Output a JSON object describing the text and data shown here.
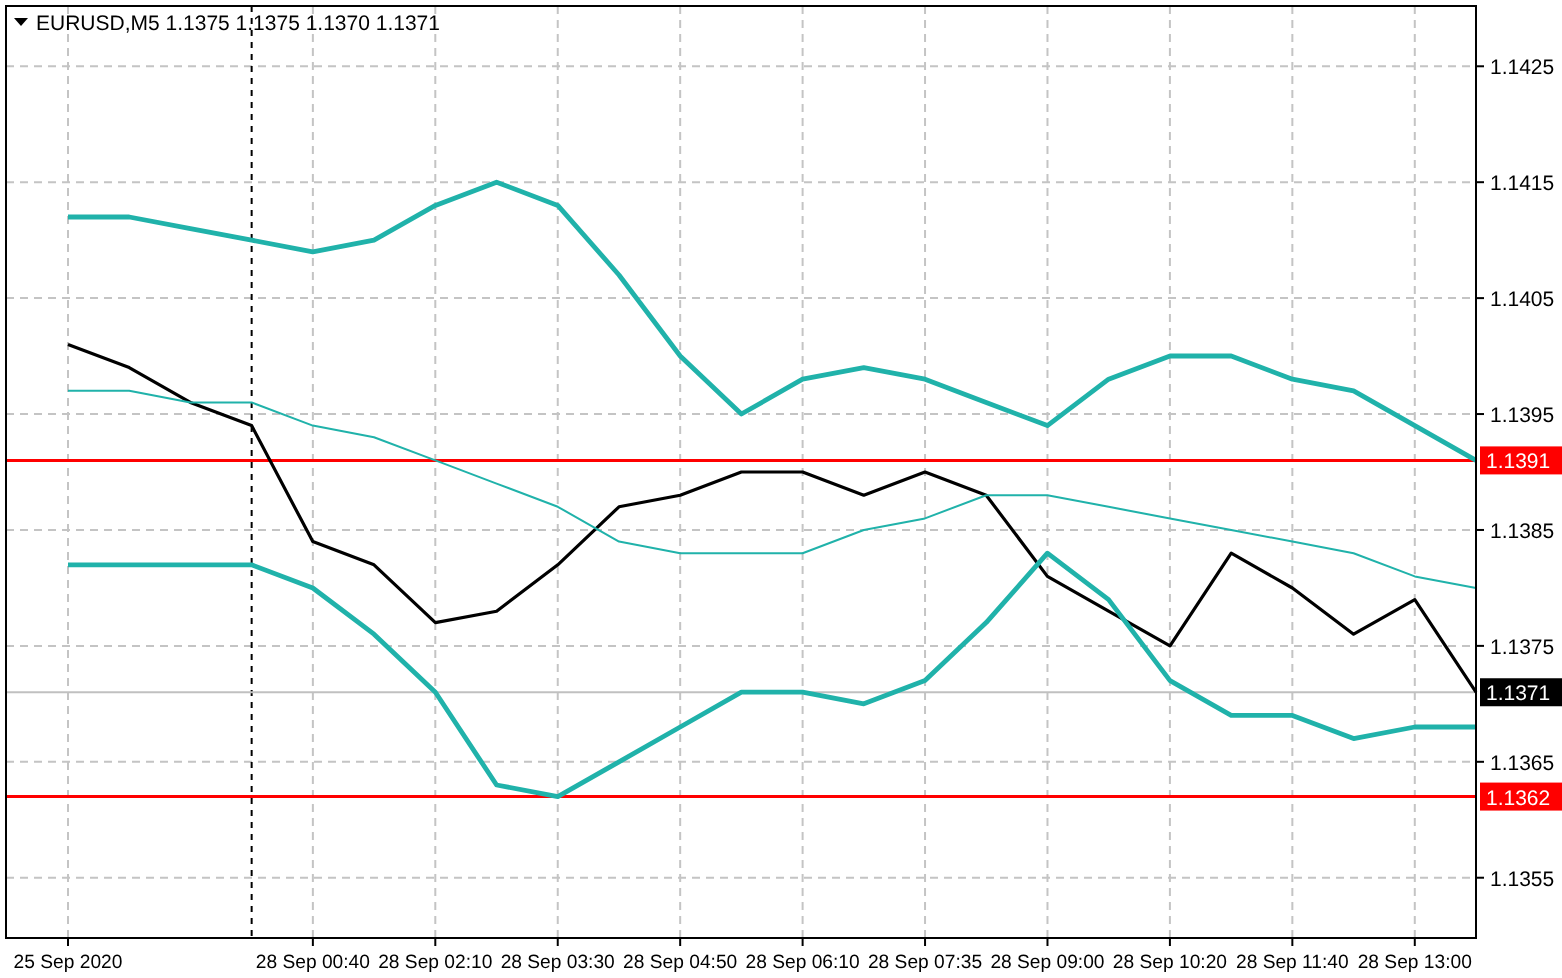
{
  "chart": {
    "symbol": "EURUSD,M5",
    "ohlc": [
      "1.1375",
      "1.1375",
      "1.1370",
      "1.1371"
    ],
    "chart_data": {
      "type": "line",
      "grid": true,
      "ylim": [
        1.13498,
        1.14302
      ],
      "categories": [
        "25 Sep 2020",
        null,
        null,
        null,
        "28 Sep 00:40",
        null,
        "28 Sep 02:10",
        null,
        "28 Sep 03:30",
        null,
        "28 Sep 04:50",
        null,
        "28 Sep 06:10",
        null,
        "28 Sep 07:35",
        null,
        "28 Sep 09:00",
        null,
        "28 Sep 10:20",
        null,
        "28 Sep 11:40",
        null,
        "28 Sep 13:00",
        null
      ],
      "yticks": [
        {
          "value": 1.1355,
          "label": "1.1355"
        },
        {
          "value": 1.1365,
          "label": "1.1365"
        },
        {
          "value": 1.1375,
          "label": "1.1375"
        },
        {
          "value": 1.1385,
          "label": "1.1385"
        },
        {
          "value": 1.1395,
          "label": "1.1395"
        },
        {
          "value": 1.1405,
          "label": "1.1405"
        },
        {
          "value": 1.1415,
          "label": "1.1415"
        },
        {
          "value": 1.1425,
          "label": "1.1425"
        }
      ],
      "series": [
        {
          "color": "#000000",
          "values": [
            1.1401,
            1.1399,
            1.1396,
            1.1394,
            1.1384,
            1.1382,
            1.1377,
            1.1378,
            1.1382,
            1.1387,
            1.1388,
            1.139,
            1.139,
            1.1388,
            1.139,
            1.1388,
            1.1381,
            1.1378,
            1.1375,
            1.1383,
            1.138,
            1.1376,
            1.1379,
            1.1371
          ]
        },
        {
          "color": "#20b2aa",
          "values": [
            1.1412,
            1.1412,
            1.1411,
            1.141,
            1.1409,
            1.141,
            1.1413,
            1.1415,
            1.1413,
            1.1407,
            1.14,
            1.1395,
            1.1398,
            1.1399,
            1.1398,
            1.1396,
            1.1394,
            1.1398,
            1.14,
            1.14,
            1.1398,
            1.1397,
            1.1394,
            1.1391
          ]
        },
        {
          "color": "#20b2aa",
          "values": [
            1.1397,
            1.1397,
            1.1396,
            1.1396,
            1.1394,
            1.1393,
            1.1391,
            1.1389,
            1.1387,
            1.1384,
            1.1383,
            1.1383,
            1.1383,
            1.1385,
            1.1386,
            1.1388,
            1.1388,
            1.1387,
            1.1386,
            1.1385,
            1.1384,
            1.1383,
            1.1381,
            1.138
          ]
        },
        {
          "color": "#20b2aa",
          "values": [
            1.1382,
            1.1382,
            1.1382,
            1.1382,
            1.138,
            1.1376,
            1.1371,
            1.1363,
            1.1362,
            1.1365,
            1.1368,
            1.1371,
            1.1371,
            1.137,
            1.1372,
            1.1377,
            1.1383,
            1.1379,
            1.1372,
            1.1369,
            1.1369,
            1.1367,
            1.1368,
            1.1368
          ]
        }
      ],
      "ref_lines": [
        {
          "axis": "y",
          "value": 1.1391,
          "label": "1.1391",
          "color": "#ff0000"
        },
        {
          "axis": "y",
          "value": 1.1371,
          "label": "1.1371",
          "color": "#c0c0c0"
        },
        {
          "axis": "y",
          "value": 1.1362,
          "label": "1.1362",
          "color": "#ff0000"
        }
      ]
    }
  }
}
